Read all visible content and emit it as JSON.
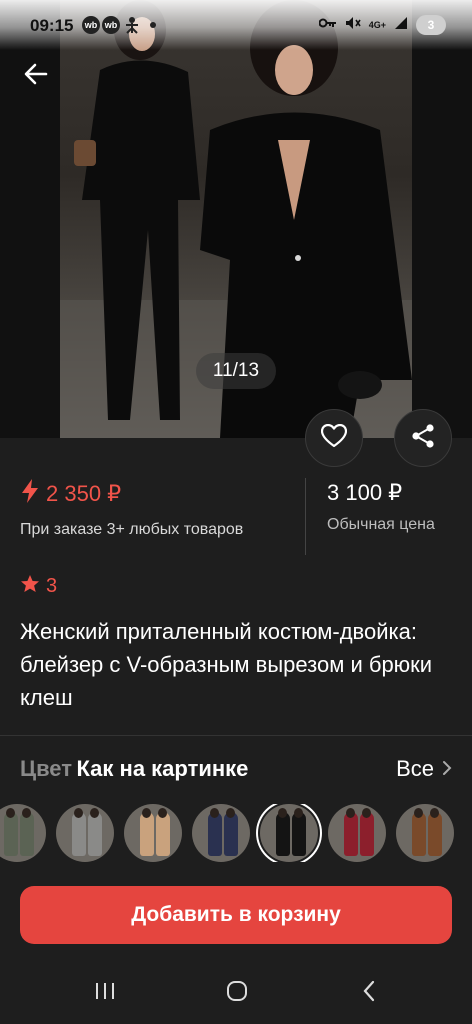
{
  "status_bar": {
    "time": "09:15",
    "app_badges": [
      "wb",
      "wb"
    ],
    "network_label": "4G+",
    "battery": "3"
  },
  "gallery": {
    "counter": "11/13",
    "icons": {
      "back": "arrow-left-icon",
      "favorite": "heart-icon",
      "share": "share-icon"
    }
  },
  "price": {
    "promo_value": "2 350 ₽",
    "promo_note": "При заказе 3+ любых товаров",
    "regular_value": "3 100 ₽",
    "regular_note": "Обычная цена"
  },
  "rating": {
    "value": "3"
  },
  "product": {
    "title": "Женский приталенный костюм-двойка: блейзер с V-образным вырезом и брюки клеш"
  },
  "color": {
    "label": "Цвет",
    "value": "Как на картинке",
    "all_label": "Все",
    "swatches": [
      {
        "color": "#5b6354"
      },
      {
        "color": "#8a8a88"
      },
      {
        "color": "#c9a27d"
      },
      {
        "color": "#2a3150"
      },
      {
        "color": "#141414",
        "selected": true
      },
      {
        "color": "#8c1f2c"
      },
      {
        "color": "#7a4a2a"
      }
    ]
  },
  "actions": {
    "add_to_cart": "Добавить в корзину"
  },
  "colors": {
    "accent": "#e5453f",
    "promo": "#f1544a",
    "background": "#1e1e1e"
  },
  "navbar": {
    "icons": [
      "recent-apps-icon",
      "home-icon",
      "back-icon"
    ]
  }
}
